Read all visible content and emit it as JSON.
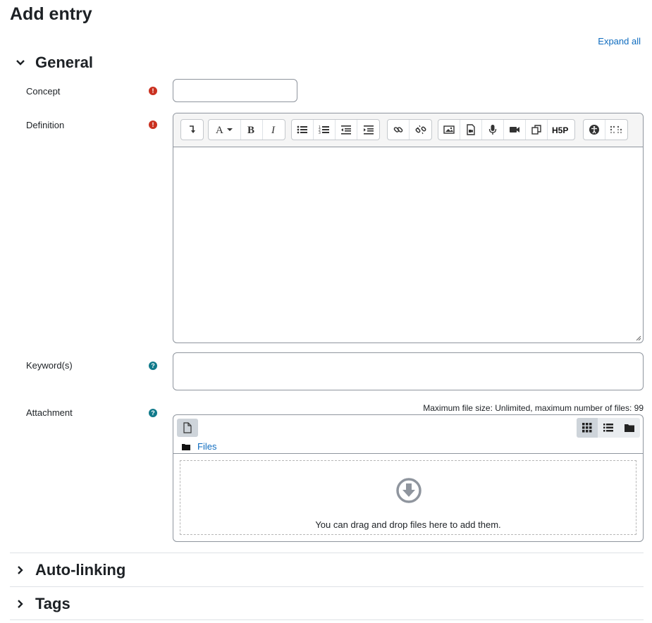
{
  "page": {
    "title": "Add entry",
    "expand_all": "Expand all"
  },
  "general": {
    "title": "General",
    "concept_label": "Concept",
    "concept_value": "",
    "definition_label": "Definition",
    "definition_value": "",
    "keywords_label": "Keyword(s)",
    "keywords_value": "",
    "attachment_label": "Attachment",
    "max_file_info": "Maximum file size: Unlimited, maximum number of files: 99",
    "files_path": "Files",
    "drop_text": "You can drag and drop files here to add them."
  },
  "toolbar": {
    "groups": [
      [
        "collapse-toggle"
      ],
      [
        "font-color",
        "bold",
        "italic"
      ],
      [
        "unordered-list",
        "ordered-list",
        "outdent",
        "indent"
      ],
      [
        "link",
        "unlink"
      ],
      [
        "image",
        "media-file",
        "record-audio",
        "record-video",
        "manage-files",
        "h5p"
      ],
      [
        "accessibility-checker",
        "screenreader-helper"
      ]
    ]
  },
  "sections": {
    "autolinking": "Auto-linking",
    "tags": "Tags"
  },
  "colors": {
    "required": "#ca3120",
    "help": "#117a8b",
    "link": "#0f6cbf"
  }
}
